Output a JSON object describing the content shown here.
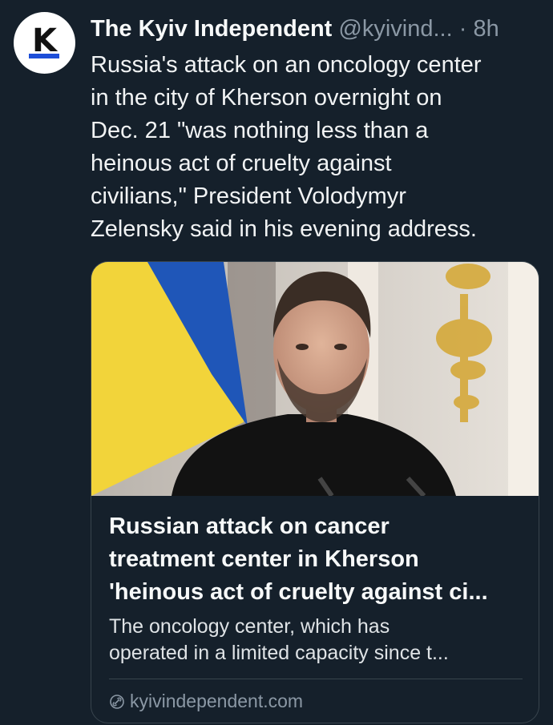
{
  "tweet": {
    "author_name": "The Kyiv Independent",
    "author_handle": "@kyivind...",
    "separator": "·",
    "timestamp": "8h",
    "avatar_letter": "K",
    "text_lines": [
      "Russia's attack on an oncology center",
      "in the city of Kherson overnight on",
      "Dec. 21 \"was nothing less than a",
      "heinous act of cruelty against",
      "civilians,\" President Volodymyr",
      "Zelensky said in his evening address."
    ]
  },
  "card": {
    "title_lines": [
      "Russian attack on cancer",
      "treatment center in Kherson",
      "'heinous act of cruelty against ci..."
    ],
    "description_lines": [
      "The oncology center, which has",
      "operated in a limited capacity since t..."
    ],
    "domain": "kyivindependent.com",
    "domain_icon": "link-icon"
  },
  "colors": {
    "background": "#15202b",
    "text": "#e7e9ea",
    "muted": "#8b98a5",
    "border": "#38444d",
    "flag_blue": "#1f56b8",
    "flag_yellow": "#f2d43a"
  }
}
